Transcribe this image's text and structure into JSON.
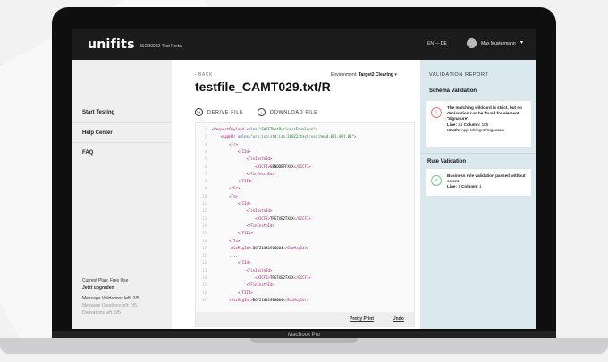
{
  "header": {
    "logo": "unifits",
    "subtitle": "ISO20022 Test Portal",
    "lang_en": "EN",
    "lang_de": "DE",
    "user_name": "Max Mustermann"
  },
  "sidebar": {
    "items": [
      {
        "label": "Start Testing"
      },
      {
        "label": "Help Center"
      },
      {
        "label": "FAQ"
      }
    ],
    "plan": {
      "current": "Current Plan: Free Use",
      "upgrade": "Jetzt upgraden",
      "validations": "Message Validations left: 2/5",
      "creations": "Message Creations left: 0/5",
      "derivations": "Derivations left: 0/5"
    }
  },
  "main": {
    "back": "BACK",
    "environment_label": "Environment:",
    "environment_value": "Target2 Clearing",
    "title": "testfile_CAMT029.txt/R",
    "derive": "DERIVE FILE",
    "download": "DOWNLOAD FILE",
    "code_lines": [
      {
        "n": "1",
        "t": "<RequestPayload xmlns=\"SWIFTNetBusinessEnvelope\">"
      },
      {
        "n": "2",
        "t": "    <AppHdr xmlns=\"urn:iso:std:iso:20022:tech:xsd:head.001.001.01\">"
      },
      {
        "n": "3",
        "t": "        <Fr>"
      },
      {
        "n": "4",
        "t": "            <FIId>"
      },
      {
        "n": "5",
        "t": "                <FinInstnId>"
      },
      {
        "n": "6",
        "t": "                    <BICFI>GENODEFFXXX</BICFI>"
      },
      {
        "n": "7",
        "t": "                </FinInstnId>"
      },
      {
        "n": "8",
        "t": "            </FIId>"
      },
      {
        "n": "9",
        "t": "        </Fr>"
      },
      {
        "n": "10",
        "t": "        <To>"
      },
      {
        "n": "11",
        "t": "            <FIId>"
      },
      {
        "n": "12",
        "t": "                <FinInstnId>"
      },
      {
        "n": "13",
        "t": "                    <BICFI>TRGTXE2TXXX</BICFI>"
      },
      {
        "n": "14",
        "t": "                </FinInstnId>"
      },
      {
        "n": "15",
        "t": "            </FIId>"
      },
      {
        "n": "16",
        "t": "        </To>"
      },
      {
        "n": "17",
        "t": "        <BizMsgIdr>BOF21041900004</BizMsgIdr>"
      },
      {
        "n": "11",
        "t": "        ...."
      },
      {
        "n": "12",
        "t": "            <FIId>"
      },
      {
        "n": "13",
        "t": "                <FinInstnId>"
      },
      {
        "n": "14",
        "t": "                    <BICFI>TRGTXE2TXXX</BICFI>"
      },
      {
        "n": "15",
        "t": "                </FinInstnId>"
      },
      {
        "n": "16",
        "t": "            </FIId>"
      },
      {
        "n": "17",
        "t": "        <BizMsgIdr>BOF21041900004</BizMsgIdr>"
      }
    ],
    "pretty_print": "Pretty Print",
    "undo": "Undo"
  },
  "report": {
    "title": "VALIDATION REPORT",
    "schema_heading": "Schema Validation",
    "schema_card": {
      "message": "The matching wildcard is strict, but no declaration can be found for element 'Signature'.",
      "line_label": "Line:",
      "line": "21",
      "column_label": "Column:",
      "column": "108",
      "xpath_label": "XPath:",
      "xpath": "AppHdr/Sgntr/Signature"
    },
    "rule_heading": "Rule Validation",
    "rule_card": {
      "message": "Business rule validation passed without errors",
      "line_label": "Line:",
      "line": "1",
      "column_label": "Column:",
      "column": "1"
    }
  },
  "device_label": "MacBook Pro"
}
